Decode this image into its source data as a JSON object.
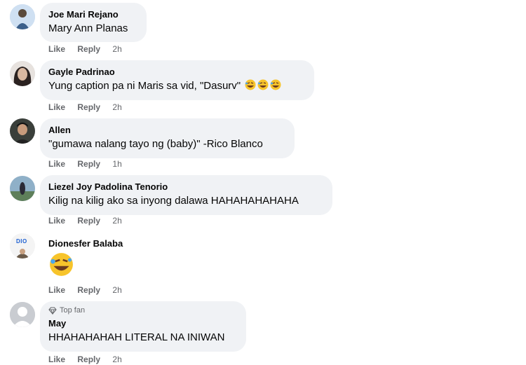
{
  "comments": [
    {
      "name": "Joe Mari Rejano",
      "text": "Mary Ann Planas",
      "like": "Like",
      "reply": "Reply",
      "time": "2h"
    },
    {
      "name": "Gayle Padrinao",
      "text": "Yung caption pa ni Maris sa vid, \"Dasurv\"",
      "like": "Like",
      "reply": "Reply",
      "time": "2h",
      "emojis": [
        "rofl-emoji",
        "rofl-emoji",
        "rofl-emoji"
      ]
    },
    {
      "name": "Allen",
      "text": "\"gumawa nalang tayo ng (baby)\" -Rico Blanco",
      "like": "Like",
      "reply": "Reply",
      "time": "1h"
    },
    {
      "name": "Liezel Joy Padolina Tenorio",
      "text": "Kilig na kilig ako sa inyong dalawa HAHAHAHAHAHA",
      "like": "Like",
      "reply": "Reply",
      "time": "2h"
    },
    {
      "name": "Dionesfer Balaba",
      "text": "",
      "like": "Like",
      "reply": "Reply",
      "time": "2h",
      "emojis": [
        "rofl-emoji"
      ],
      "avatar_text": "DIO"
    },
    {
      "badge": "Top fan",
      "name": "May",
      "text": "HHAHAHAHAH LITERAL NA INIWAN",
      "like": "Like",
      "reply": "Reply",
      "time": "2h"
    }
  ],
  "colors": {
    "bubble": "#f0f2f5",
    "meta": "#65676b",
    "text": "#050505"
  }
}
